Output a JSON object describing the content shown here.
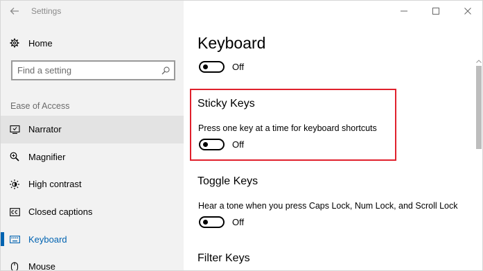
{
  "titlebar": {
    "app_title": "Settings",
    "back_icon": "arrow-left-icon",
    "controls": [
      "minimize-icon",
      "maximize-icon",
      "close-icon"
    ]
  },
  "sidebar": {
    "home_label": "Home",
    "search_placeholder": "Find a setting",
    "section_heading": "Ease of Access",
    "items": [
      {
        "label": "Narrator",
        "icon": "narrator-icon",
        "state": "hover"
      },
      {
        "label": "Magnifier",
        "icon": "magnifier-icon"
      },
      {
        "label": "High contrast",
        "icon": "high-contrast-icon"
      },
      {
        "label": "Closed captions",
        "icon": "closed-captions-icon"
      },
      {
        "label": "Keyboard",
        "icon": "keyboard-icon",
        "state": "selected"
      },
      {
        "label": "Mouse",
        "icon": "mouse-icon"
      }
    ]
  },
  "main": {
    "page_title": "Keyboard",
    "onscreen_toggle": {
      "state": "Off"
    },
    "sticky_keys": {
      "title": "Sticky Keys",
      "description": "Press one key at a time for keyboard shortcuts",
      "toggle_state": "Off"
    },
    "toggle_keys": {
      "title": "Toggle Keys",
      "description": "Hear a tone when you press Caps Lock, Num Lock, and Scroll Lock",
      "toggle_state": "Off"
    },
    "filter_keys": {
      "title": "Filter Keys"
    }
  },
  "colors": {
    "accent": "#0063b1",
    "highlight_border": "#e0202c",
    "sidebar_bg": "#f2f2f2",
    "hover_bg": "#e3e3e3"
  }
}
